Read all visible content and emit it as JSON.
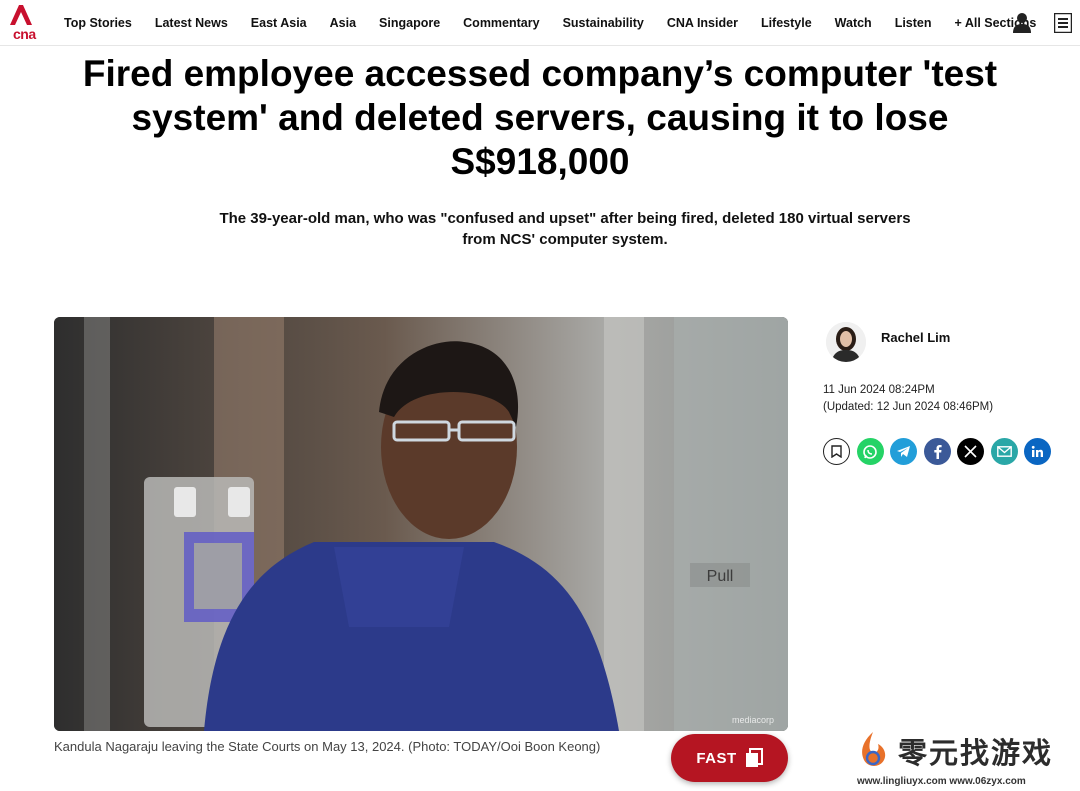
{
  "brand": {
    "logo_text": "cna",
    "accent_color": "#c8102e"
  },
  "nav": {
    "items": [
      "Top Stories",
      "Latest News",
      "East Asia",
      "Asia",
      "Singapore",
      "Commentary",
      "Sustainability",
      "CNA Insider",
      "Lifestyle",
      "Watch",
      "Listen",
      "+ All Sections"
    ],
    "user_icon": "user-icon",
    "menu_icon": "menu-icon"
  },
  "article": {
    "headline": "Fired employee accessed company’s computer 'test system' and deleted servers, causing it to lose S$918,000",
    "subtitle": "The 39-year-old man, who was \"confused and upset\" after being fired, deleted 180 virtual servers from NCS' computer system.",
    "image_watermark": "mediacorp",
    "image_sign_text": "Pull",
    "caption": "Kandula Nagaraju leaving the State Courts on May 13, 2024. (Photo: TODAY/Ooi Boon Keong)"
  },
  "author": {
    "name": "Rachel Lim",
    "published": "11 Jun 2024 08:24PM",
    "updated": "(Updated: 12 Jun 2024 08:46PM)"
  },
  "share": [
    {
      "icon": "bookmark-icon",
      "color": "#ffffff"
    },
    {
      "icon": "whatsapp-icon",
      "color": "#25d366"
    },
    {
      "icon": "telegram-icon",
      "color": "#229ed9"
    },
    {
      "icon": "facebook-icon",
      "color": "#3b5998"
    },
    {
      "icon": "x-icon",
      "color": "#000000"
    },
    {
      "icon": "email-icon",
      "color": "#2aa7a7"
    },
    {
      "icon": "linkedin-icon",
      "color": "#0a66c2"
    }
  ],
  "fast_button": {
    "label": "FAST"
  },
  "site_watermark": {
    "title": "零元找游戏",
    "urls": "www.lingliuyx.com   www.06zyx.com"
  }
}
